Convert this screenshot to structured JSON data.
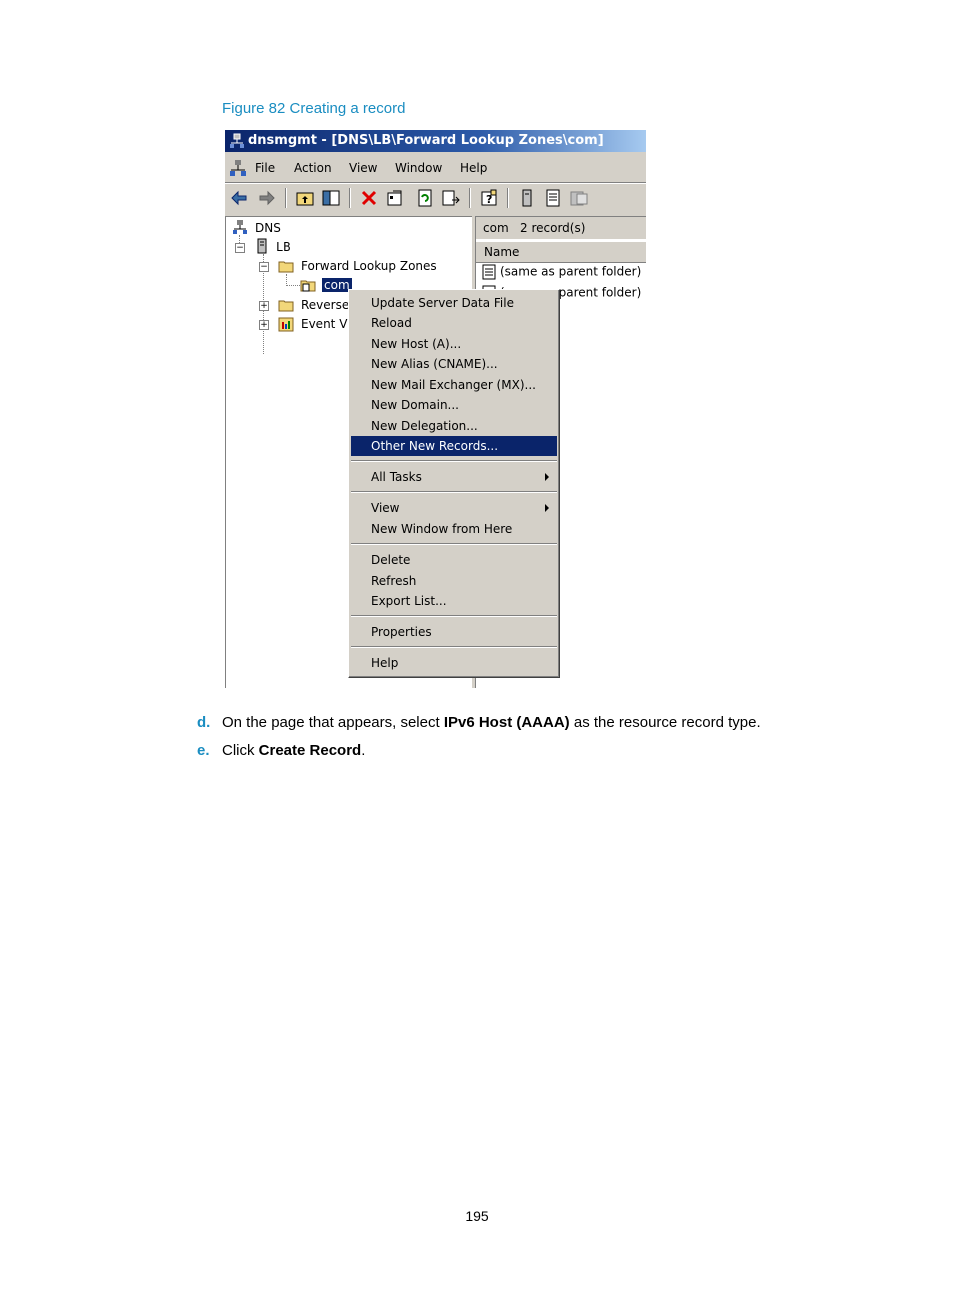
{
  "figure_caption": "Figure 82 Creating a record",
  "window": {
    "title": "dnsmgmt - [DNS\\LB\\Forward Lookup Zones\\com]",
    "menu": [
      "File",
      "Action",
      "View",
      "Window",
      "Help"
    ],
    "toolbar_icons": [
      "back-icon",
      "forward-icon",
      "up-folder-icon",
      "show-hide-tree-icon",
      "delete-icon",
      "properties-icon",
      "refresh-icon",
      "export-list-icon",
      "help-icon",
      "server-icon",
      "record-icon",
      "zone-icon"
    ],
    "tree": {
      "root": "DNS",
      "server": "LB",
      "forward_zones": "Forward Lookup Zones",
      "selected_zone": "com",
      "reverse": "Reverse",
      "event": "Event Vi"
    },
    "right_pane": {
      "zone": "com",
      "record_count": "2 record(s)",
      "column": "Name",
      "rows": [
        "(same as parent folder)",
        "(same as parent folder)"
      ]
    },
    "context_menu": {
      "groups": [
        [
          "Update Server Data File",
          "Reload",
          "New Host (A)...",
          "New Alias (CNAME)...",
          "New Mail Exchanger (MX)...",
          "New Domain...",
          "New Delegation...",
          "Other New Records..."
        ],
        [
          "All Tasks"
        ],
        [
          "View",
          "New Window from Here"
        ],
        [
          "Delete",
          "Refresh",
          "Export List..."
        ],
        [
          "Properties"
        ],
        [
          "Help"
        ]
      ],
      "highlighted": "Other New Records..."
    }
  },
  "steps": [
    {
      "marker": "d.",
      "pre": "On the page that appears, select ",
      "bold": "IPv6 Host (AAAA)",
      "post": " as the resource record type."
    },
    {
      "marker": "e.",
      "pre": "Click ",
      "bold": "Create Record",
      "post": "."
    }
  ],
  "page_number": "195",
  "colors": {
    "caption": "#1a8dc1",
    "title_bar": "#0a246a",
    "menu_highlight": "#0a246a",
    "chrome": "#d4d0c8"
  }
}
